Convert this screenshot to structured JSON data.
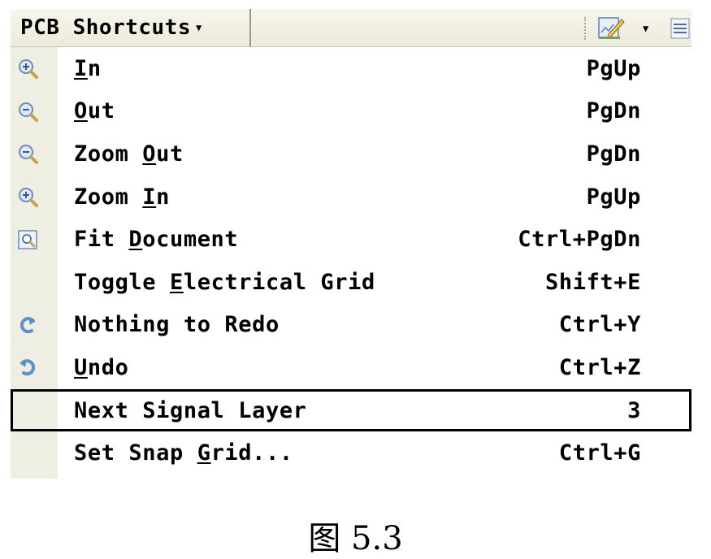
{
  "toolbar": {
    "title": "PCB Shortcuts",
    "dropdown_icon": "caret-down-icon",
    "right_icons": [
      "document-edit-icon",
      "caret-down-icon",
      "list-icon"
    ]
  },
  "menu": {
    "items": [
      {
        "pre": "",
        "ul": "I",
        "post": "n",
        "shortcut": "PgUp",
        "icon": "zoom-in-icon"
      },
      {
        "pre": "",
        "ul": "O",
        "post": "ut",
        "shortcut": "PgDn",
        "icon": "zoom-out-icon"
      },
      {
        "pre": "Zoom ",
        "ul": "O",
        "post": "ut",
        "shortcut": "PgDn",
        "icon": "zoom-out-icon"
      },
      {
        "pre": "Zoom ",
        "ul": "I",
        "post": "n",
        "shortcut": "PgUp",
        "icon": "zoom-in-icon"
      },
      {
        "pre": "Fit ",
        "ul": "D",
        "post": "ocument",
        "shortcut": "Ctrl+PgDn",
        "icon": "fit-document-icon"
      },
      {
        "pre": "Toggle ",
        "ul": "E",
        "post": "lectrical Grid",
        "shortcut": "Shift+E",
        "icon": ""
      },
      {
        "pre": "Nothing to Redo",
        "ul": "",
        "post": "",
        "shortcut": "Ctrl+Y",
        "icon": "redo-icon"
      },
      {
        "pre": "",
        "ul": "U",
        "post": "ndo",
        "shortcut": "Ctrl+Z",
        "icon": "undo-icon"
      },
      {
        "pre": "Next Signal Layer",
        "ul": "",
        "post": "",
        "shortcut": "3",
        "icon": ""
      },
      {
        "pre": "Set Snap ",
        "ul": "G",
        "post": "rid...",
        "shortcut": "Ctrl+G",
        "icon": ""
      }
    ]
  },
  "caption": "图 5.3"
}
